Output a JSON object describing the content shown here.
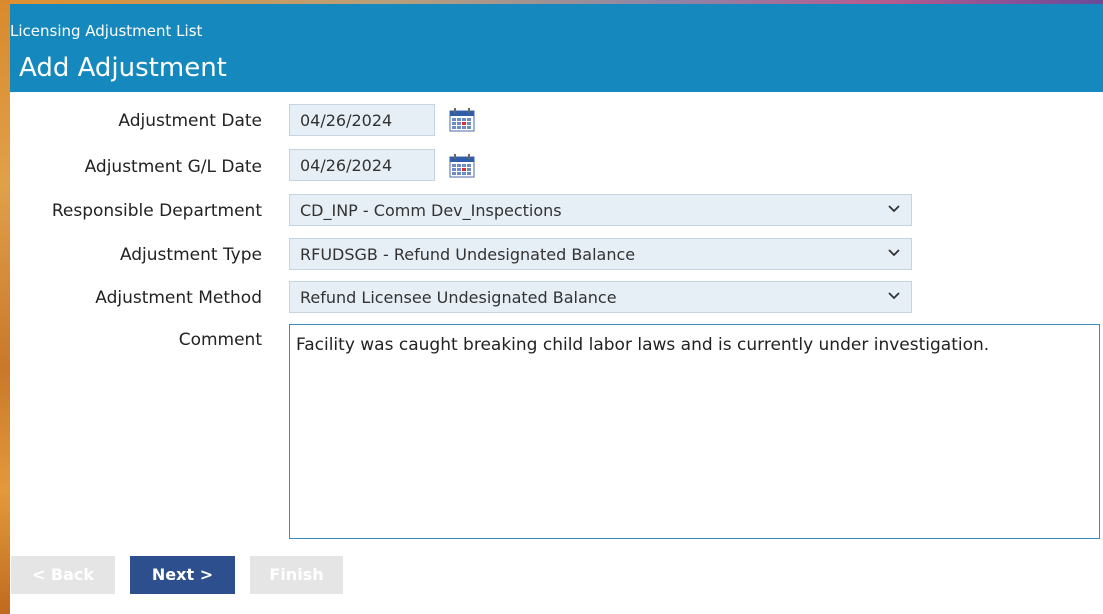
{
  "header": {
    "breadcrumb": "Licensing Adjustment List",
    "title": "Add Adjustment",
    "bg_color": "#1589bd"
  },
  "form": {
    "adjustment_date": {
      "label": "Adjustment Date",
      "value": "04/26/2024",
      "icon": "calendar-icon"
    },
    "gl_date": {
      "label": "Adjustment G/L Date",
      "value": "04/26/2024",
      "icon": "calendar-icon"
    },
    "department": {
      "label": "Responsible Department",
      "value": "CD_INP - Comm Dev_Inspections"
    },
    "adjustment_type": {
      "label": "Adjustment Type",
      "value": "RFUDSGB - Refund Undesignated Balance"
    },
    "adjustment_method": {
      "label": "Adjustment Method",
      "value": "Refund Licensee Undesignated Balance"
    },
    "comment": {
      "label": "Comment",
      "value": "Facility was caught breaking child labor laws and is currently under investigation."
    }
  },
  "buttons": {
    "back": "< Back",
    "next": "Next >",
    "finish": "Finish",
    "primary_color": "#2e4f8d"
  }
}
